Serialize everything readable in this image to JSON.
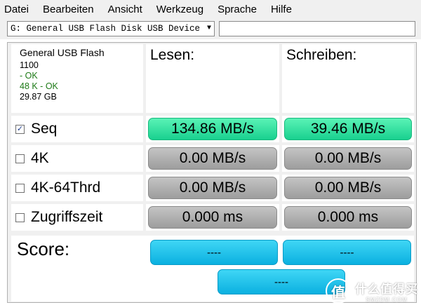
{
  "menu": [
    "Datei",
    "Bearbeiten",
    "Ansicht",
    "Werkzeug",
    "Sprache",
    "Hilfe"
  ],
  "drive_select": {
    "value": "G: General USB Flash Disk USB Device"
  },
  "device_info": {
    "name": "General USB Flash",
    "firmware": "1100",
    "status1": " - OK",
    "status2": "48 K - OK",
    "size": "29.87 GB"
  },
  "columns": {
    "read": "Lesen:",
    "write": "Schreiben:"
  },
  "rows": [
    {
      "label": "Seq",
      "checked": true,
      "read": "134.86 MB/s",
      "write": "39.46 MB/s",
      "state": "done"
    },
    {
      "label": "4K",
      "checked": false,
      "read": "0.00 MB/s",
      "write": "0.00 MB/s",
      "state": "idle"
    },
    {
      "label": "4K-64Thrd",
      "checked": false,
      "read": "0.00 MB/s",
      "write": "0.00 MB/s",
      "state": "idle"
    },
    {
      "label": "Zugriffszeit",
      "checked": false,
      "read": "0.000 ms",
      "write": "0.000 ms",
      "state": "idle"
    }
  ],
  "score": {
    "label": "Score:",
    "read": "----",
    "write": "----",
    "total": "----"
  },
  "watermark": {
    "badge": "值",
    "main": "什么值得买",
    "sub": "SMZDM.COM"
  },
  "colors": {
    "done_bar": "#2de0a0",
    "idle_bar": "#b0b0b0",
    "score_bar": "#1ec3ee",
    "ok_text": "#1d7a16"
  }
}
